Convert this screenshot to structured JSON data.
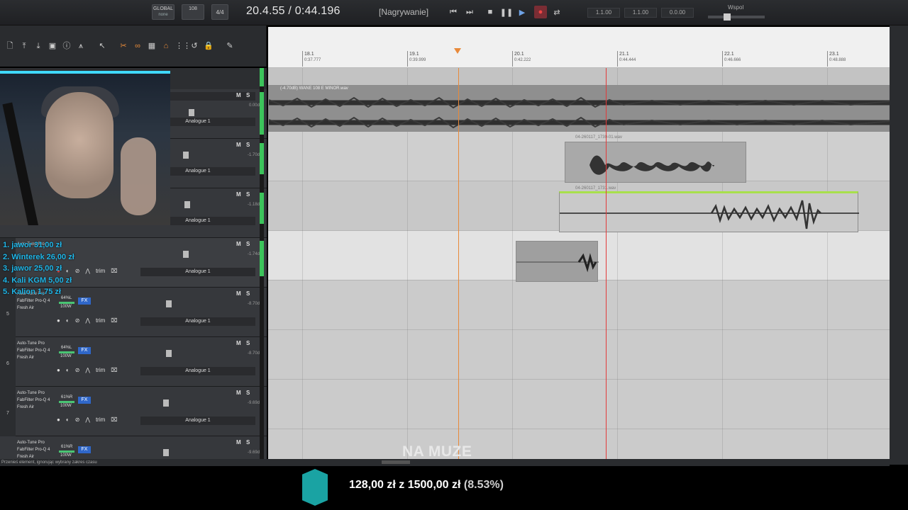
{
  "transport": {
    "global_label": "GLOBAL",
    "global_sub": "none",
    "tempo": "108",
    "meter": "4/4",
    "time": "20.4.55 / 0:44.196",
    "status": "[Nagrywanie]",
    "field1": "1.1.00",
    "field2": "1.1.00",
    "field3": "0.0.00",
    "wspol": "Wspol"
  },
  "ruler": {
    "marks": [
      {
        "bar": "18.1",
        "time": "0:37.777"
      },
      {
        "bar": "19.1",
        "time": "0:39.999"
      },
      {
        "bar": "20.1",
        "time": "0:42.222"
      },
      {
        "bar": "21.1",
        "time": "0:44.444"
      },
      {
        "bar": "22.1",
        "time": "0:46.666"
      },
      {
        "bar": "23.1",
        "time": "0:48.888"
      }
    ]
  },
  "clips": {
    "beat": "(-4.70dB) WANE 108 E MINOR.wav",
    "vox1": "04-260117_1730-01.wav",
    "vox2": "04-260117_1731.wav"
  },
  "tracks": [
    {
      "num": "",
      "name": "E MINOR",
      "db": "0.00dB",
      "output": "Analogue 1",
      "plugins": [],
      "fx": "",
      "level": ""
    },
    {
      "num": "",
      "name": "",
      "db": "-1.70dB",
      "output": "Analogue 1",
      "plugins": [],
      "fx": "",
      "level": ""
    },
    {
      "num": "",
      "name": "",
      "db": "-1.18dB",
      "output": "Analogue 1",
      "plugins": [],
      "fx": "",
      "level": ""
    },
    {
      "num": "",
      "name": "",
      "db": "-1.74dB",
      "output": "Analogue 1",
      "plugins": [
        "Auto-Tune Pro"
      ],
      "fx": "",
      "level": ""
    },
    {
      "num": "5",
      "name": "",
      "db": "-8.70dB",
      "output": "Analogue 1",
      "plugins": [
        "Auto-Tune Pro",
        "FabFilter Pro-Q 4",
        "Fresh Air"
      ],
      "fx": "64%L",
      "level": "100W"
    },
    {
      "num": "6",
      "name": "",
      "db": "-8.70dB",
      "output": "Analogue 1",
      "plugins": [
        "Auto-Tune Pro",
        "FabFilter Pro-Q 4",
        "Fresh Air"
      ],
      "fx": "64%L",
      "level": "100W"
    },
    {
      "num": "7",
      "name": "",
      "db": "-9.69dB",
      "output": "Analogue 1",
      "plugins": [
        "Auto-Tune Pro",
        "FabFilter Pro-Q 4",
        "Fresh Air"
      ],
      "fx": "61%R",
      "level": "100W"
    },
    {
      "num": "",
      "name": "",
      "db": "-9.69dB",
      "output": "",
      "plugins": [
        "Auto-Tune Pro",
        "FabFilter Pro-Q 4",
        "Fresh Air"
      ],
      "fx": "61%R",
      "level": "100W"
    }
  ],
  "track_controls": {
    "m": "M",
    "s": "S",
    "fx": "FX",
    "trim": "trim"
  },
  "donors": [
    "1. jawor 31,00 zł",
    "2. Winterek 26,00 zł",
    "3. jawor 25,00 zł",
    "4. Kali KGM 5,00 zł",
    "5. Kalion 1,75 zł"
  ],
  "statusbar": "Przenieś element, ignorując wybrany zakres czasu",
  "overlay": {
    "title": "NA MUZE"
  },
  "goal": {
    "current": "128,00 zł",
    "target": "1500,00 zł",
    "percent": "(8.53%)"
  },
  "colors": {
    "accent": "#e8893a",
    "playhead": "#e23a3a",
    "meter": "#3cc45b",
    "fx": "#2f67c9",
    "donor": "#1fb6e8",
    "goal": "#1aa3a3"
  }
}
